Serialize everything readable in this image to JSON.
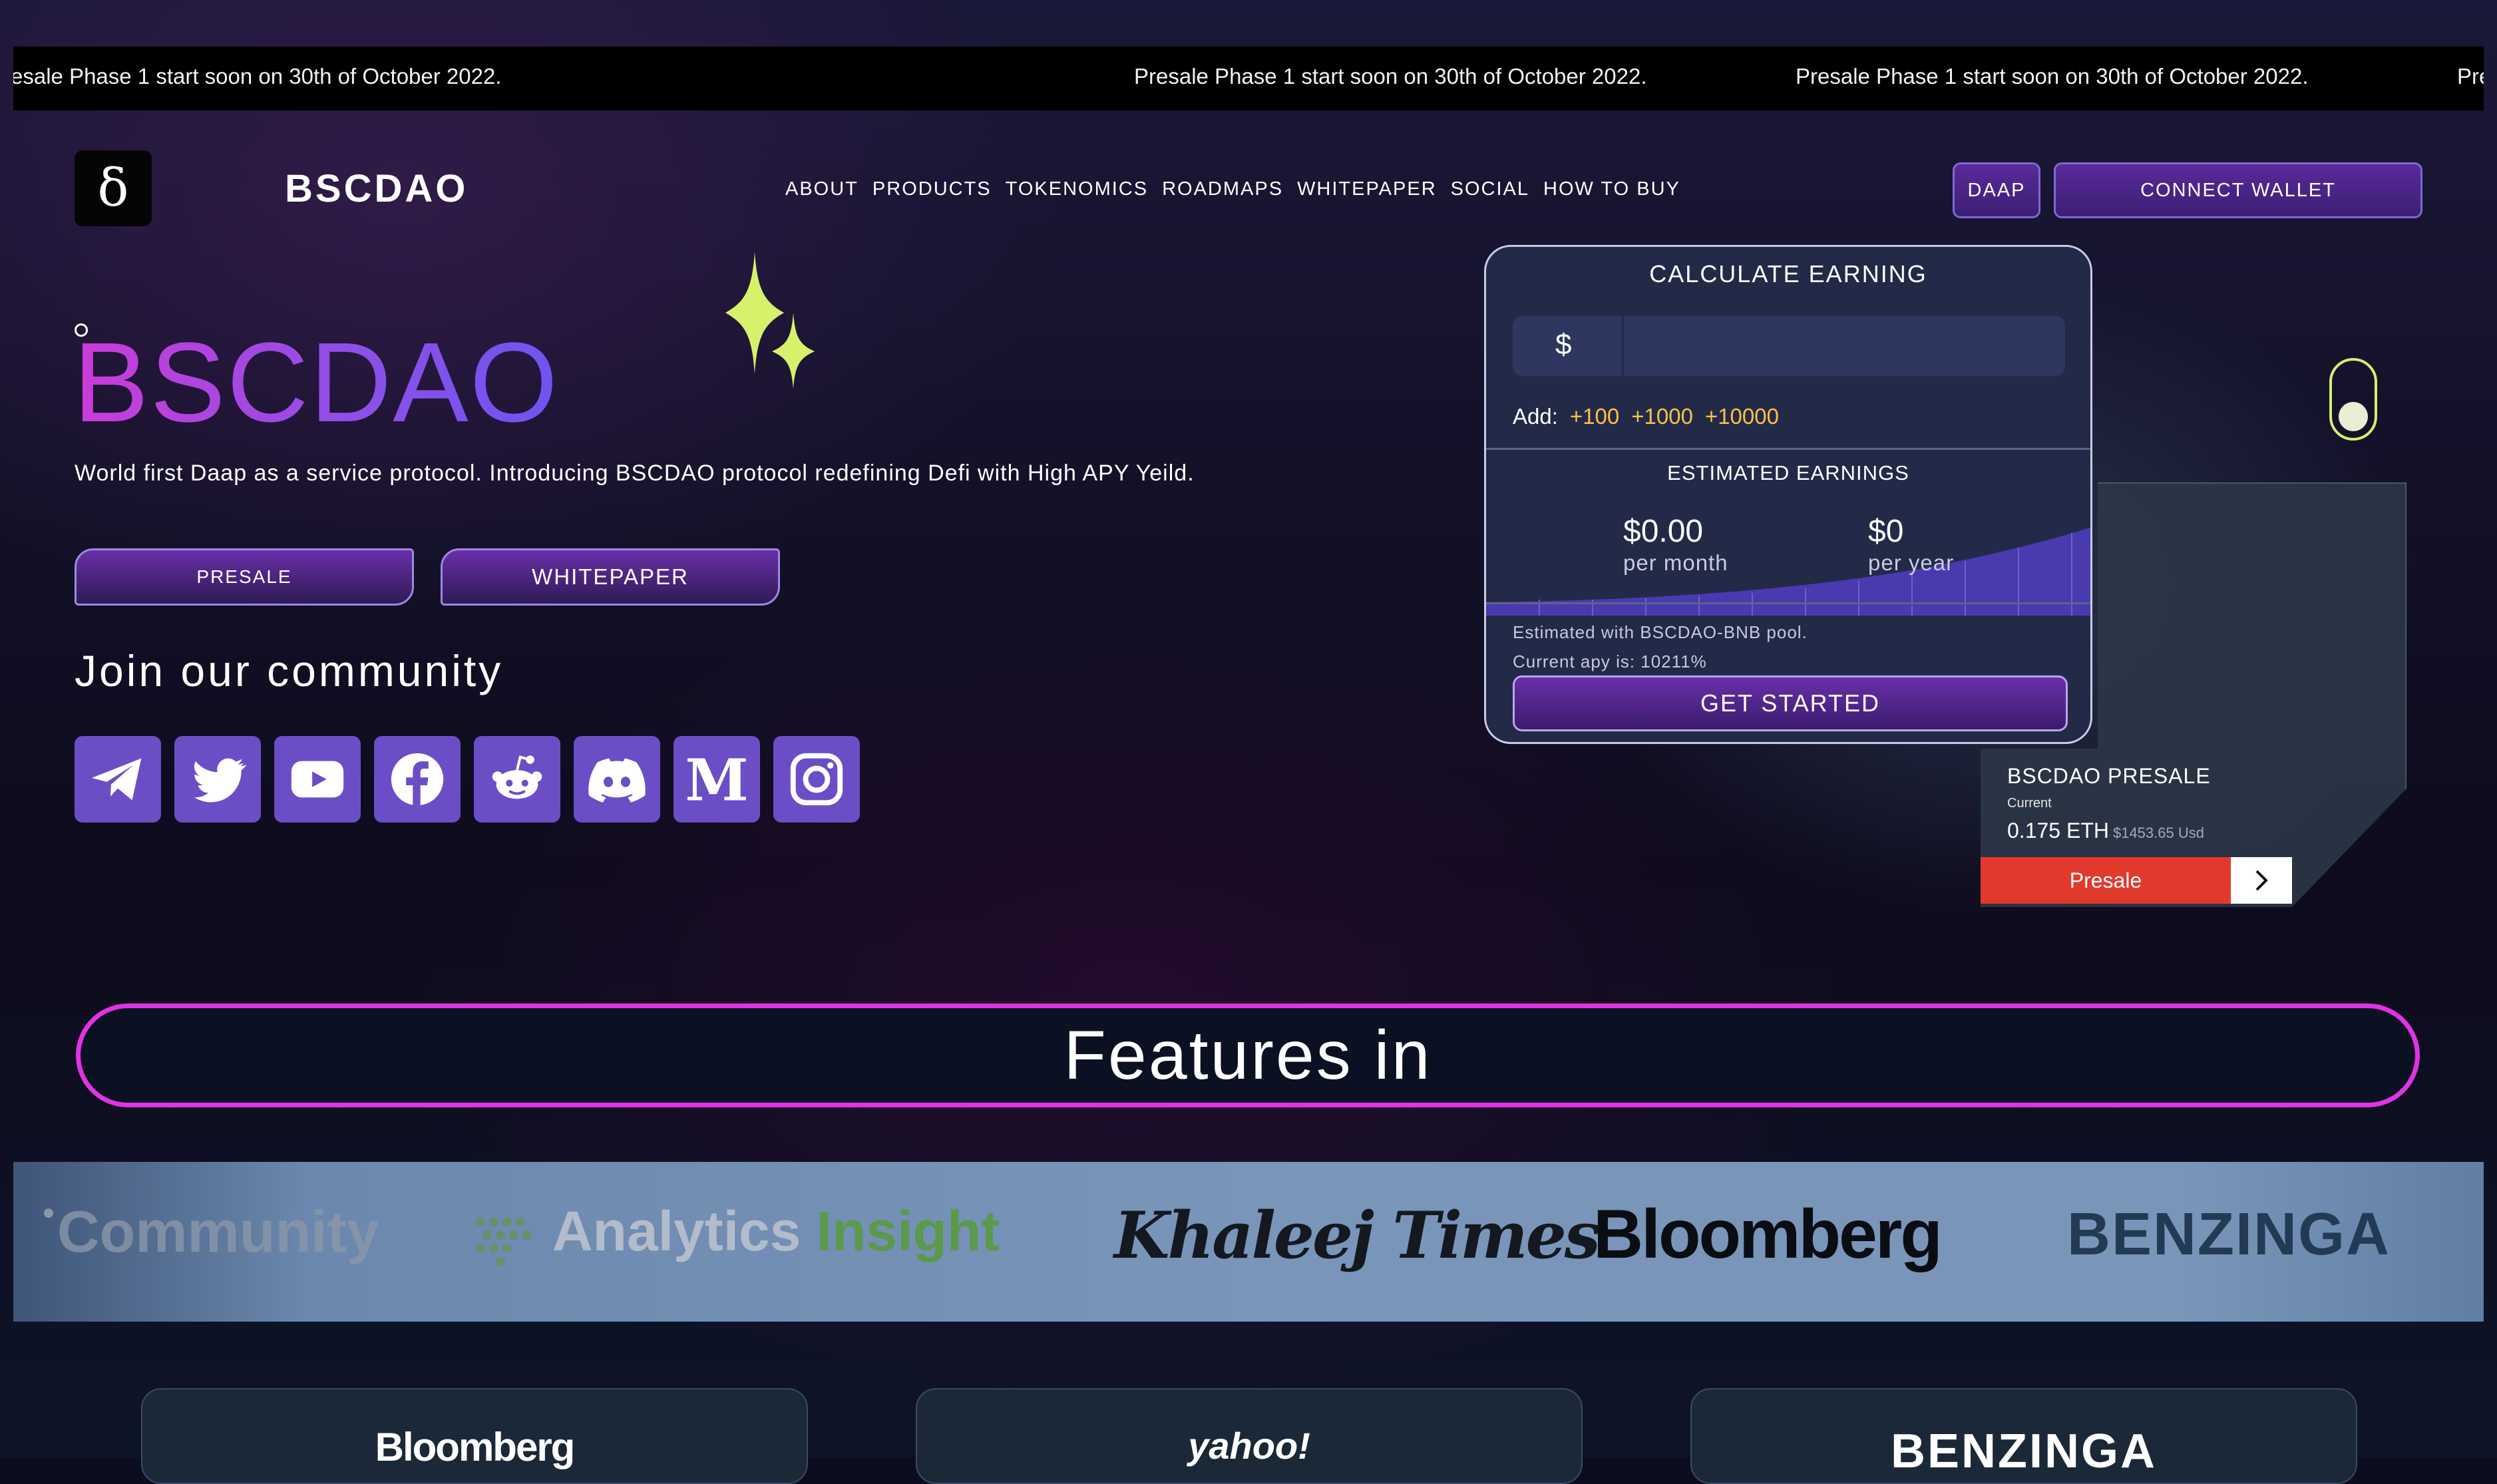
{
  "ticker": {
    "items": [
      "esale Phase 1 start soon on 30th of October 2022.",
      "Presale Phase 1 start soon on 30th of October 2022.",
      "Presale Phase 1 start soon on 30th of October 2022.",
      "Pre"
    ]
  },
  "header": {
    "logo_glyph": "δ",
    "brand": "BSCDAO",
    "nav": [
      "ABOUT",
      "PRODUCTS",
      "TOKENOMICS",
      "ROADMAPS",
      "WHITEPAPER",
      "SOCIAL",
      "HOW TO BUY"
    ],
    "daap_label": "DAAP",
    "connect_label": "CONNECT WALLET"
  },
  "hero": {
    "title": "BSCDAO",
    "subtitle": "World first Daap as a service protocol. Introducing BSCDAO protocol redefining Defi with High APY Yeild.",
    "presale_label": "PRESALE",
    "whitepaper_label": "WHITEPAPER",
    "community_heading": "Join our community",
    "socials": [
      "telegram-icon",
      "twitter-icon",
      "youtube-icon",
      "facebook-icon",
      "reddit-icon",
      "discord-icon",
      "medium-icon",
      "instagram-icon"
    ]
  },
  "calculator": {
    "title": "CALCULATE EARNING",
    "currency": "$",
    "amount": "",
    "add_label": "Add:",
    "add_options": [
      "+100",
      "+1000",
      "+10000"
    ],
    "estimated_title": "ESTIMATED EARNINGS",
    "month_value": "$0.00",
    "month_label": "per month",
    "year_value": "$0",
    "year_label": "per year",
    "note_pool": "Estimated with BSCDAO-BNB pool.",
    "note_apy": "Current apy is: 10211%",
    "cta": "GET STARTED"
  },
  "presale_widget": {
    "title": "BSCDAO PRESALE",
    "current_label": "Current",
    "price_eth": "0.175 ETH",
    "price_usd": "$1453.65 Usd",
    "button": "Presale"
  },
  "features": {
    "heading": "Features in",
    "press": [
      "Community",
      "Analytics",
      "Insight",
      "Khaleej Times",
      "Bloomberg",
      "BENZINGA"
    ],
    "cards": [
      "Bloomberg",
      "yahoo!",
      "BENZINGA"
    ]
  },
  "colors": {
    "accent_purple": "#6b4ec6",
    "accent_magenta": "#e232e6",
    "presale_red": "#e2392d",
    "add_amount": "#ffc247"
  }
}
